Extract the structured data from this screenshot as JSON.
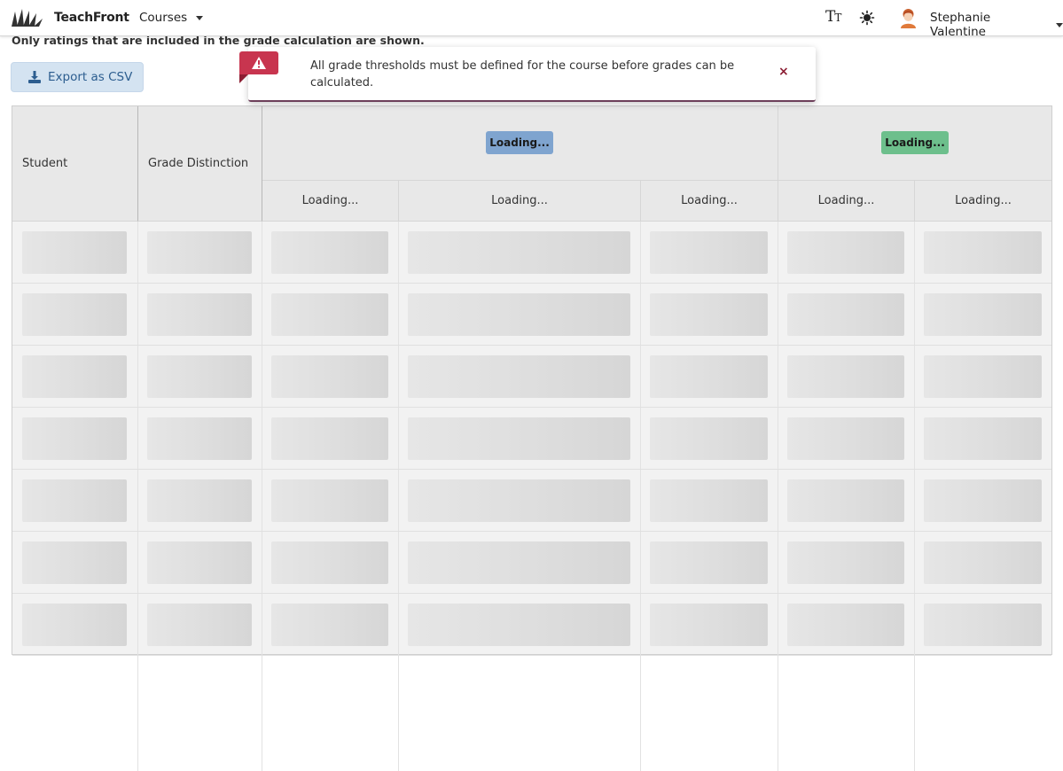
{
  "navbar": {
    "brand": "TeachFront",
    "courses_label": "Courses",
    "user_name": "Stephanie Valentine",
    "textsize_icon": "text-size-icon",
    "theme_icon": "sun-icon"
  },
  "info_text": "Only ratings that are included in the grade calculation are shown.",
  "export_button": "Export as CSV",
  "toast": {
    "message": "All grade thresholds must be defined for the course before grades can be calculated.",
    "close": "×",
    "icon": "warning-icon",
    "flag_color": "#c8354f"
  },
  "table": {
    "col_student": "Student",
    "col_grade": "Grade Distinction",
    "group_1_label": "Loading...",
    "group_1_color": "#7fa4cf",
    "group_2_label": "Loading...",
    "group_2_color": "#6dbf8c",
    "sub_headers": [
      "Loading...",
      "Loading...",
      "Loading...",
      "Loading...",
      "Loading..."
    ]
  }
}
